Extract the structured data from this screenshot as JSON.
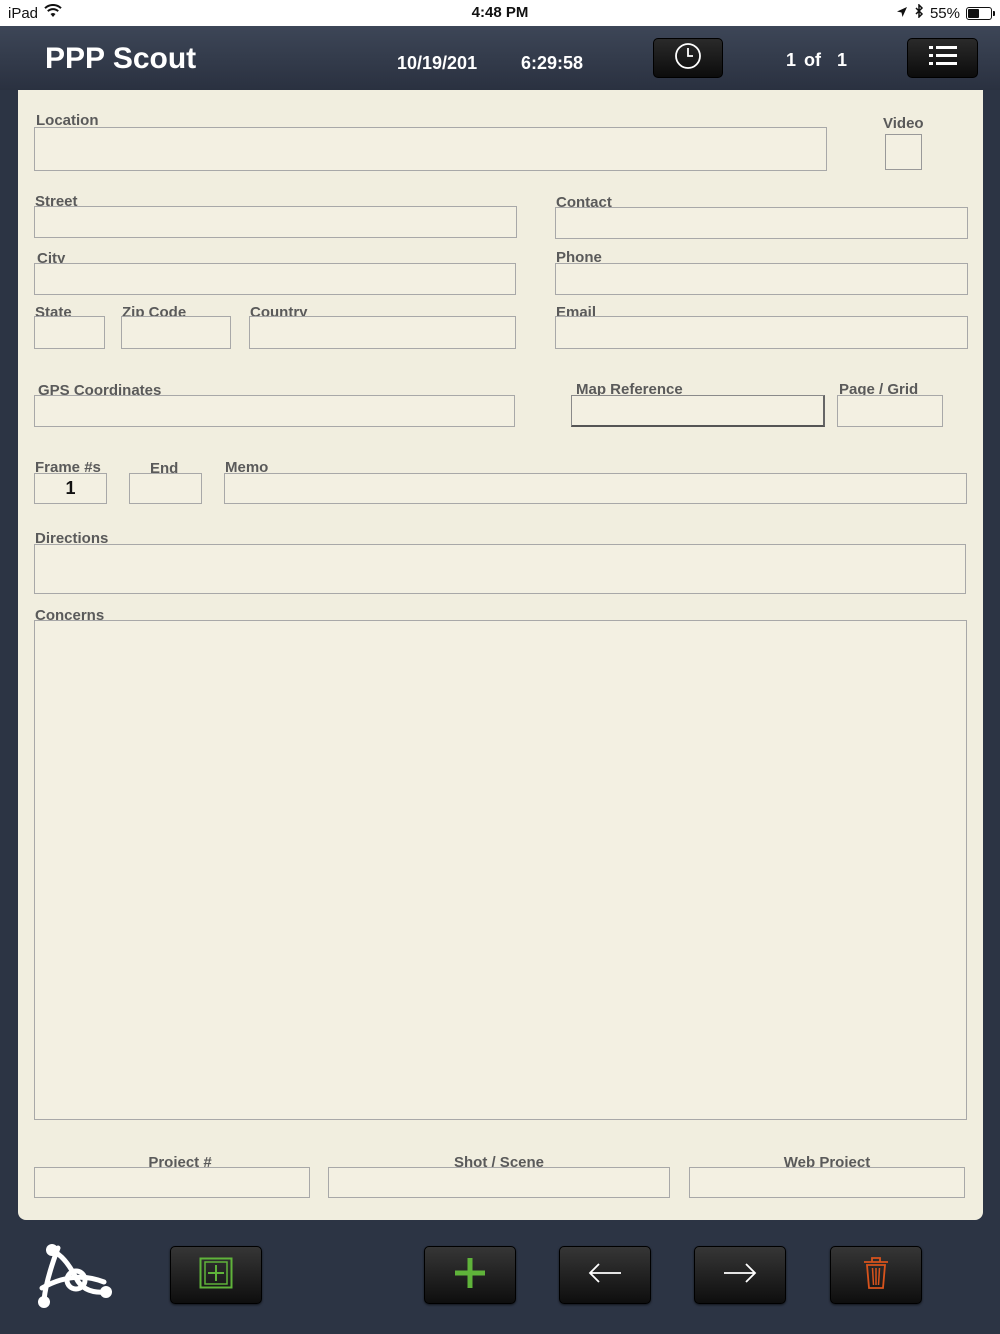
{
  "status_bar": {
    "device": "iPad",
    "time": "4:48 PM",
    "battery": "55%",
    "battery_level": 0.55,
    "icons": [
      "wifi-icon",
      "location-arrow-icon",
      "bluetooth-icon",
      "battery-icon"
    ]
  },
  "header": {
    "title": "PPP Scout",
    "date": "10/19/201",
    "time": "6:29:58",
    "page_current": "1",
    "page_of": "of",
    "page_total": "1",
    "clock_icon": "clock-icon",
    "menu_icon": "list-menu-icon"
  },
  "form": {
    "location_label": "Location",
    "location_value": "",
    "video_label": "Video",
    "street_label": "Street",
    "street_value": "",
    "contact_label": "Contact",
    "contact_value": "",
    "city_label": "City",
    "city_value": "",
    "phone_label": "Phone",
    "phone_value": "",
    "state_label": "State",
    "state_value": "",
    "zip_label": "Zip Code",
    "zip_value": "",
    "country_label": "Country",
    "country_value": "",
    "email_label": "Email",
    "email_value": "",
    "gps_label": "GPS Coordinates",
    "gps_value": "",
    "mapref_label": "Map Reference",
    "mapref_value": "",
    "pagegrid_label": "Page / Grid",
    "pagegrid_value": "",
    "frame_label": "Frame #s",
    "frame_value": "1",
    "end_label": "End",
    "end_value": "",
    "memo_label": "Memo",
    "memo_value": "",
    "directions_label": "Directions",
    "directions_value": "",
    "concerns_label": "Concerns",
    "concerns_value": "",
    "project_label": "Project #",
    "project_value": "",
    "shot_label": "Shot / Scene",
    "shot_value": "",
    "web_label": "Web Project",
    "web_value": ""
  },
  "toolbar": {
    "logo": "app-logo-icon",
    "buttons": [
      "new-frame-icon",
      "add-icon",
      "arrow-left-icon",
      "arrow-right-icon",
      "trash-icon"
    ],
    "colors": {
      "green": "#5fb33a",
      "orange": "#d8531c"
    }
  },
  "colors": {
    "sheet": "#f1eedf",
    "background": "#2c3444",
    "field_border": "#a8a8a8",
    "label": "#5a5a5a"
  }
}
